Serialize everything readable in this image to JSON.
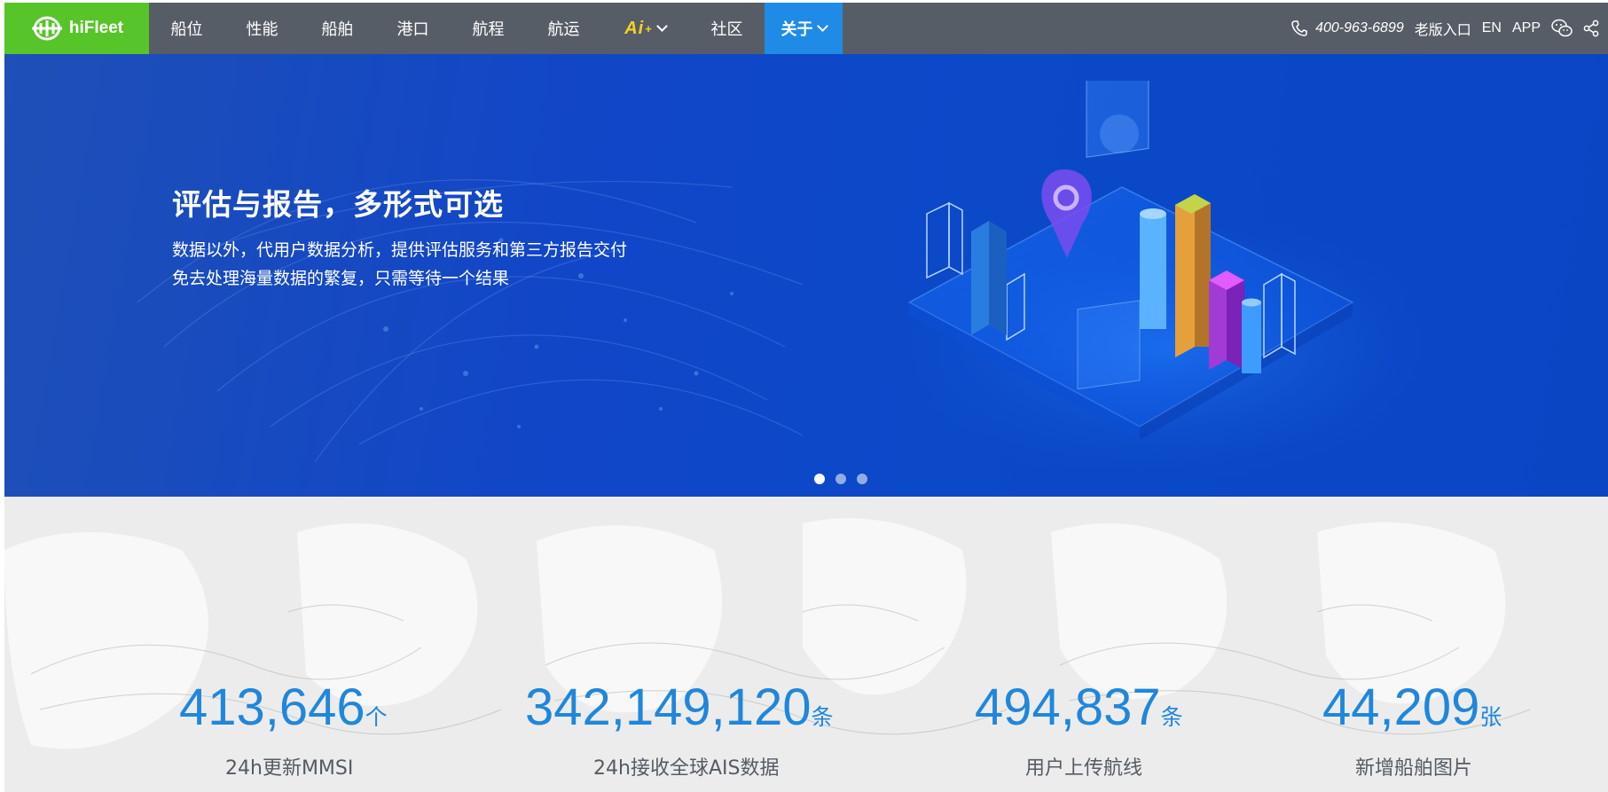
{
  "navbar": {
    "logo_text": "hiFleet",
    "items": [
      {
        "label": "船位"
      },
      {
        "label": "性能"
      },
      {
        "label": "船舶"
      },
      {
        "label": "港口"
      },
      {
        "label": "航程"
      },
      {
        "label": "航运"
      }
    ],
    "ai_label": "Ai",
    "ai_sup": "+",
    "community_label": "社区",
    "active_label": "关于",
    "phone": "400-963-6899",
    "old_version": "老版入口",
    "lang": "EN",
    "app": "APP",
    "icons": [
      "phone-icon",
      "wechat-icon",
      "share-icon"
    ],
    "colors": {
      "bar": "#575d66",
      "logo": "#57c42a",
      "active": "#1f8be6",
      "ai": "#f5d323"
    }
  },
  "banner": {
    "title": "评估与报告，多形式可选",
    "line1": "数据以外，代用户数据分析，提供评估服务和第三方报告交付",
    "line2": "免去处理海量数据的繁复，只需等待一个结果",
    "slides": 3,
    "active_slide": 1
  },
  "stats": [
    {
      "value": "413,646",
      "unit": "个",
      "label": "24h更新MMSI"
    },
    {
      "value": "342,149,120",
      "unit": "条",
      "label": "24h接收全球AIS数据"
    },
    {
      "value": "494,837",
      "unit": "条",
      "label": "用户上传航线"
    },
    {
      "value": "44,209",
      "unit": "张",
      "label": "新增船舶图片"
    }
  ],
  "accent_color": "#1f87db"
}
